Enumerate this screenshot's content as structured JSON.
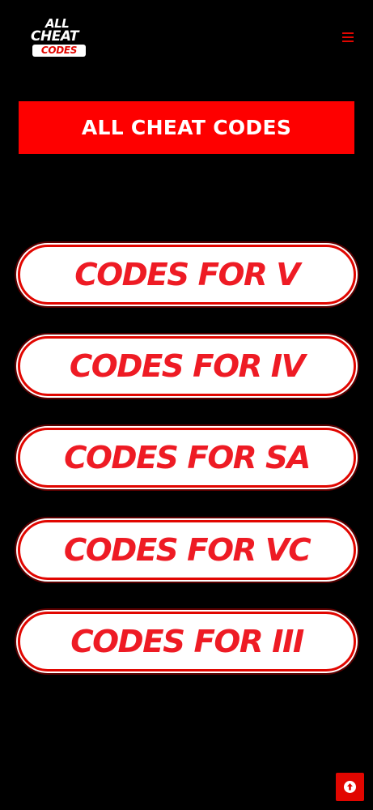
{
  "logo": {
    "line1": "ALL",
    "line2": "CHEAT",
    "line3": "CODES"
  },
  "header": {
    "menu_icon": "hamburger-menu-icon"
  },
  "banner": {
    "title": "ALL CHEAT CODES"
  },
  "buttons": [
    {
      "label": "CODES FOR V"
    },
    {
      "label": "CODES FOR IV"
    },
    {
      "label": "CODES FOR SA"
    },
    {
      "label": "CODES FOR VC"
    },
    {
      "label": "CODES FOR III"
    }
  ],
  "scroll_top": {
    "icon": "arrow-up-circle-icon"
  },
  "colors": {
    "background": "#000000",
    "accent_red": "#e10600",
    "banner_red": "#fe0000",
    "button_text": "#ee1b24",
    "button_fill": "#ffffff"
  }
}
